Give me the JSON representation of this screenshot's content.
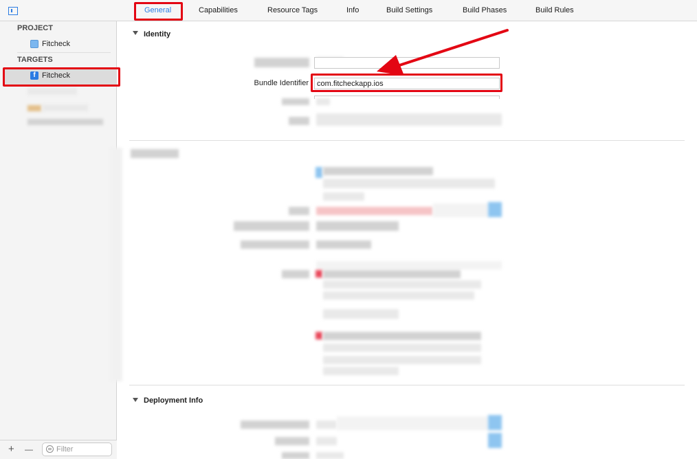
{
  "toolbar": {
    "tabs": [
      "General",
      "Capabilities",
      "Resource Tags",
      "Info",
      "Build Settings",
      "Build Phases",
      "Build Rules"
    ],
    "active_tab": "General"
  },
  "sidebar": {
    "project_header": "PROJECT",
    "project_item": "Fitcheck",
    "targets_header": "TARGETS",
    "target_item": "Fitcheck",
    "target_icon_letter": "f",
    "filter_placeholder": "Filter",
    "add_label": "+",
    "remove_label": "—"
  },
  "identity": {
    "section_title": "Identity",
    "bundle_identifier_label": "Bundle Identifier",
    "bundle_identifier_value": "com.fitcheckapp.ios"
  },
  "deployment": {
    "section_title": "Deployment Info"
  },
  "colors": {
    "accent": "#2b7ce3",
    "highlight": "#e30613"
  }
}
